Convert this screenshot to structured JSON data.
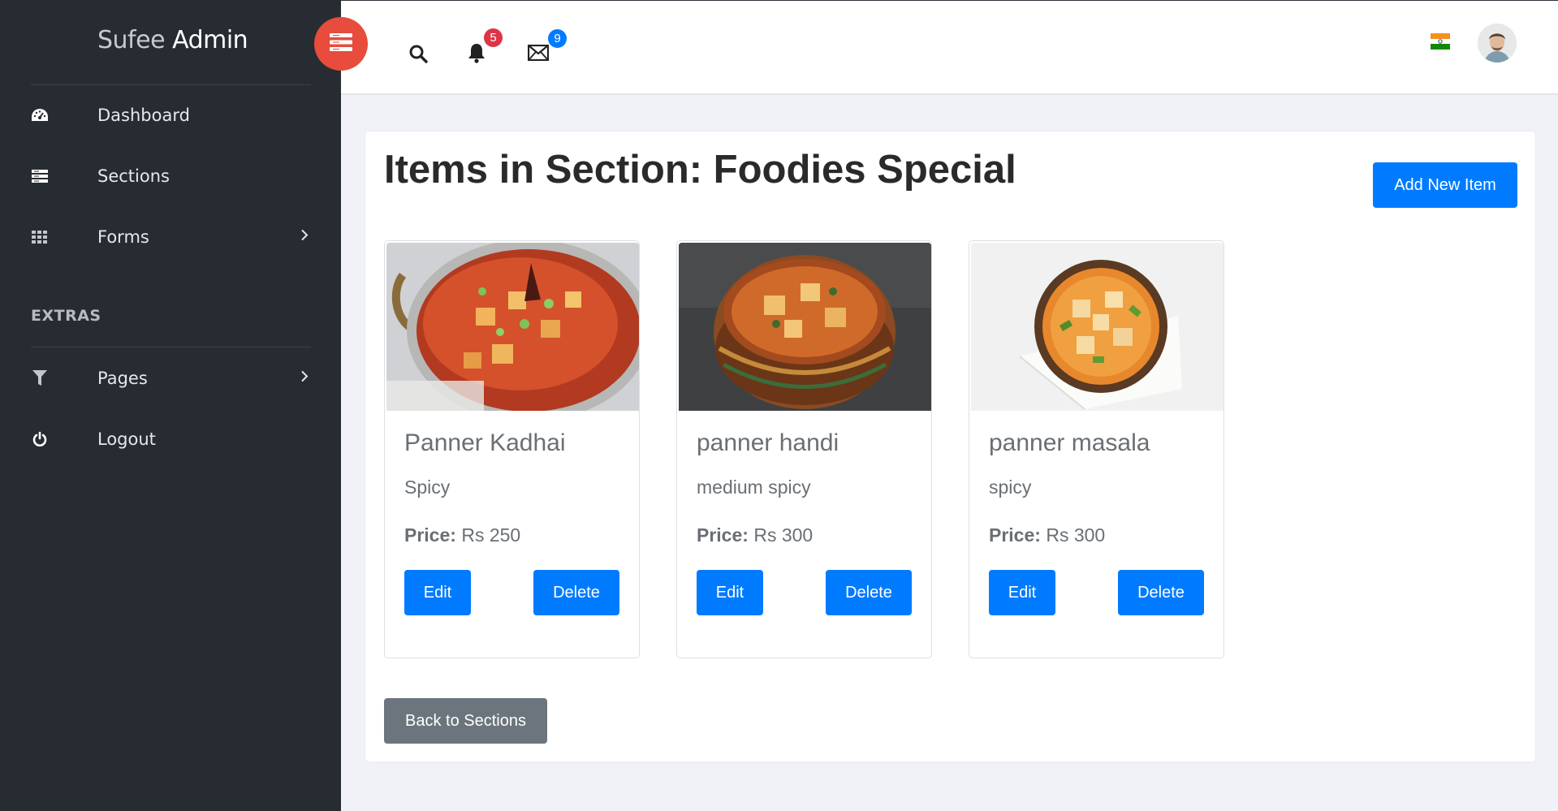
{
  "brand": {
    "light": "Sufee ",
    "bold": "Admin"
  },
  "sidebar": {
    "items": [
      {
        "label": "Dashboard",
        "icon": "dashboard-icon"
      },
      {
        "label": "Sections",
        "icon": "list-icon"
      },
      {
        "label": "Forms",
        "icon": "grid-icon"
      }
    ],
    "extras_heading": "EXTRAS",
    "extras_items": [
      {
        "label": "Pages",
        "icon": "filter-icon"
      },
      {
        "label": "Logout",
        "icon": "power-icon"
      }
    ]
  },
  "header": {
    "notifications_count": "5",
    "messages_count": "9",
    "colors": {
      "notification_badge": "#dc3545",
      "message_badge": "#007bff",
      "toggle": "#e74c3c"
    }
  },
  "page": {
    "title": "Items in Section: Foodies Special",
    "add_button": "Add New Item",
    "back_button": "Back to Sections"
  },
  "items": [
    {
      "name": "Panner Kadhai",
      "description": "Spicy",
      "price_label": "Price:",
      "price": " Rs 250",
      "edit": "Edit",
      "delete": "Delete"
    },
    {
      "name": "panner handi",
      "description": "medium spicy",
      "price_label": "Price:",
      "price": " Rs 300",
      "edit": "Edit",
      "delete": "Delete"
    },
    {
      "name": "panner masala",
      "description": "spicy",
      "price_label": "Price:",
      "price": " Rs 300",
      "edit": "Edit",
      "delete": "Delete"
    }
  ]
}
